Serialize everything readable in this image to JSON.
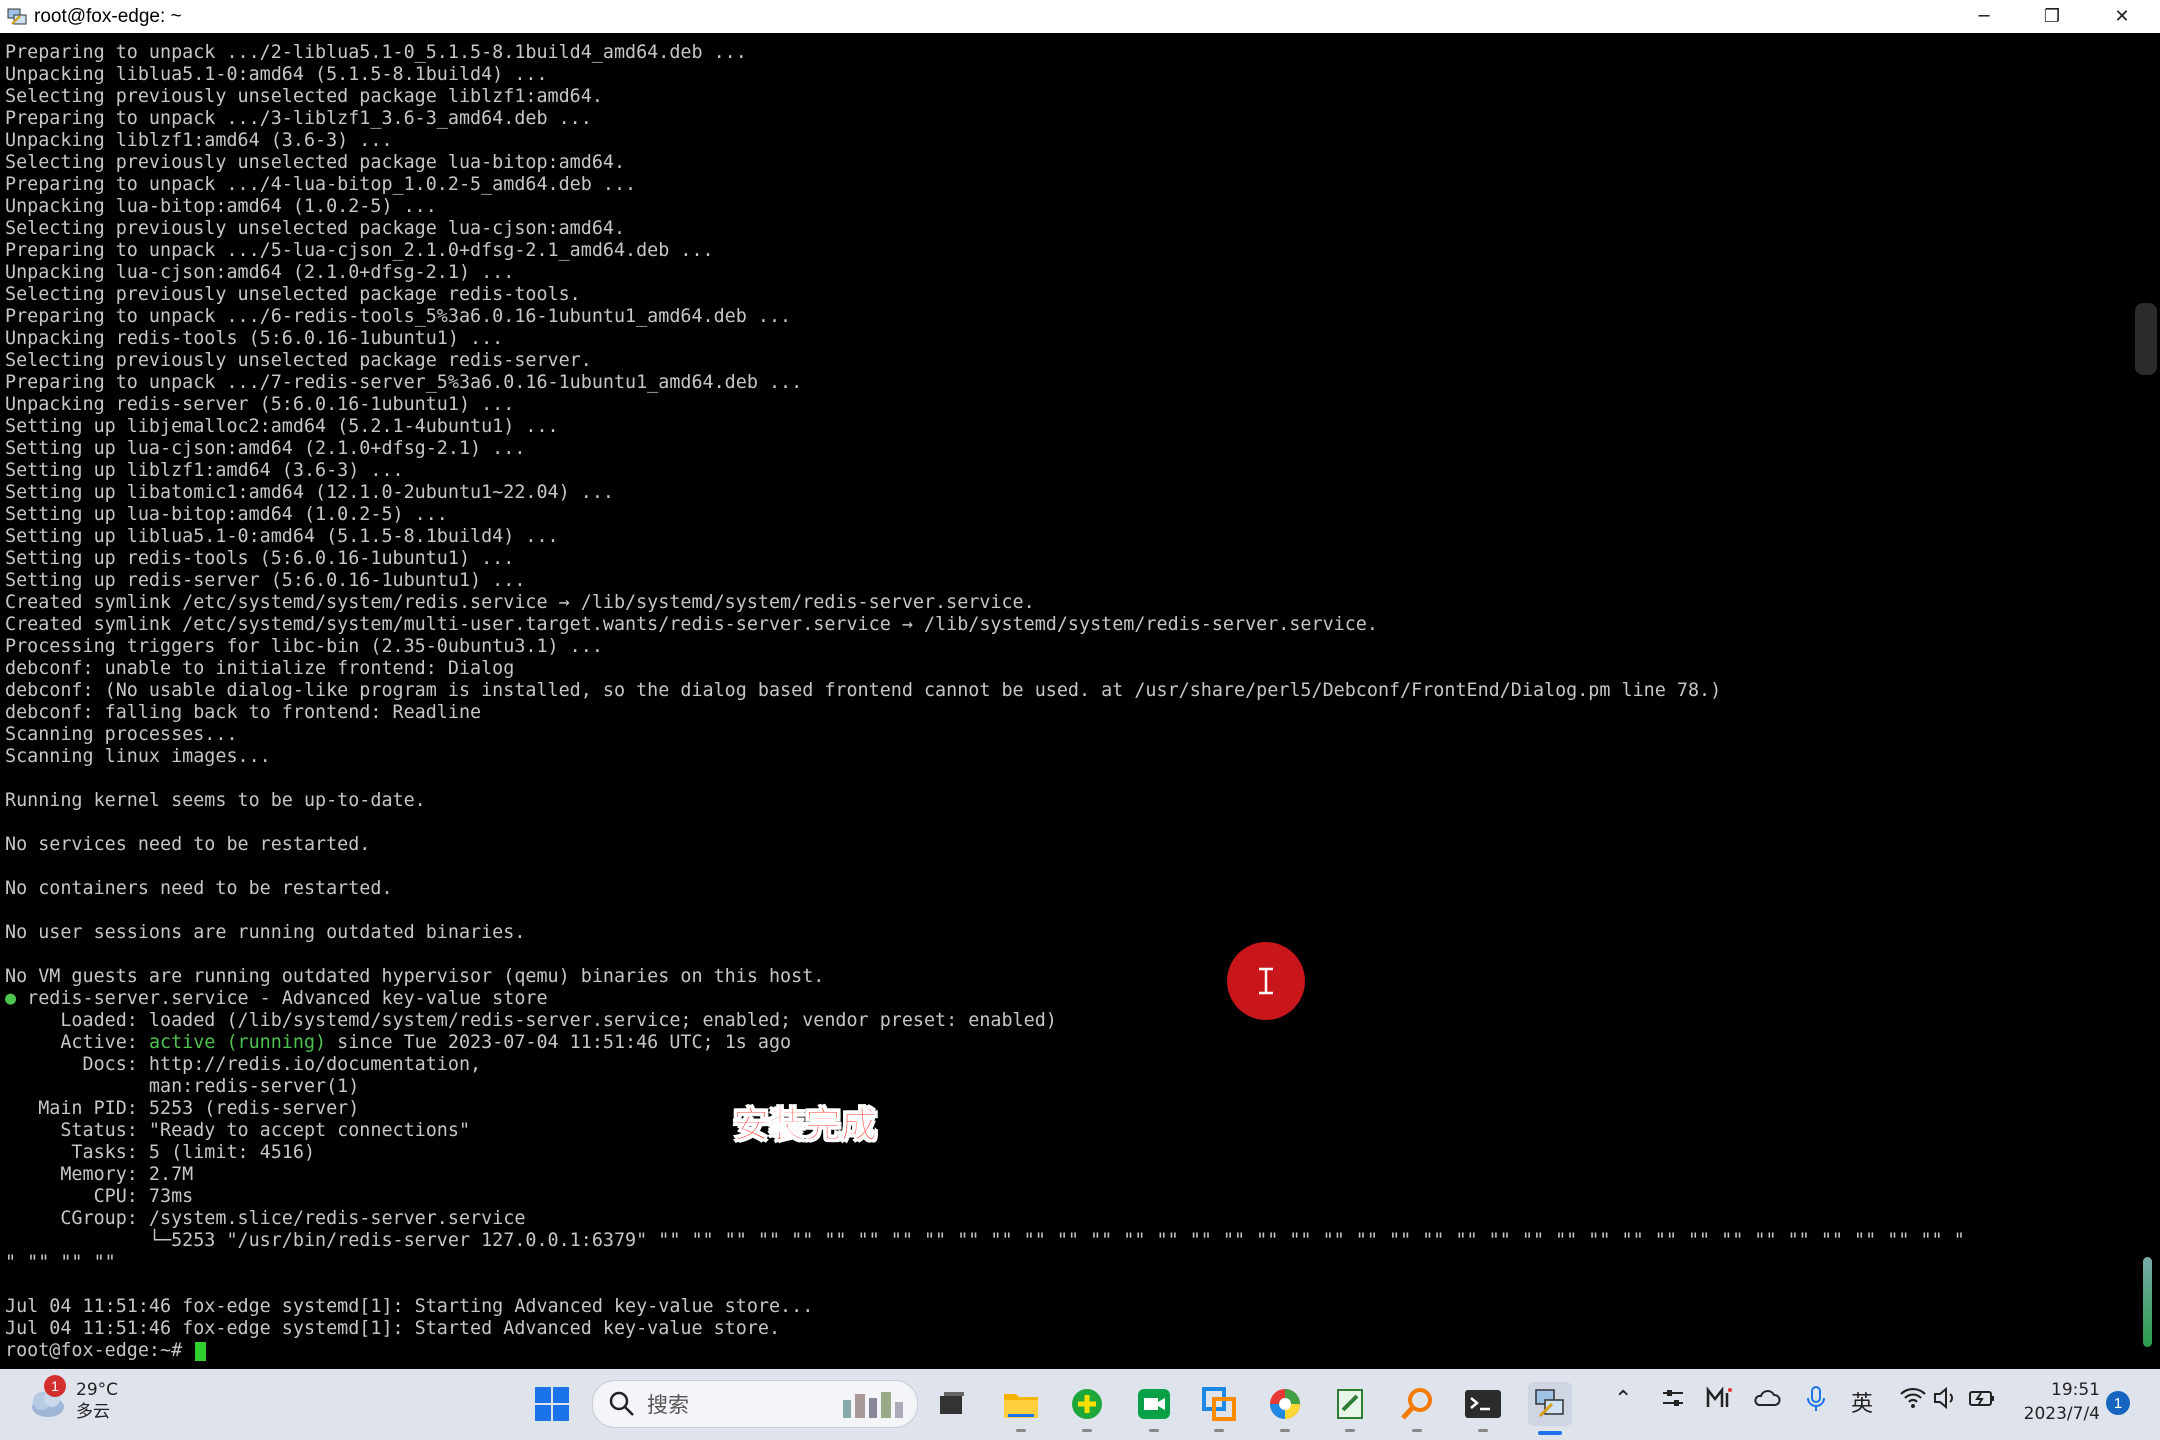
{
  "window": {
    "title": "root@fox-edge: ~",
    "minimize": "─",
    "restore": "❐",
    "close": "✕"
  },
  "terminal": {
    "lines": [
      "Preparing to unpack .../2-liblua5.1-0_5.1.5-8.1build4_amd64.deb ...",
      "Unpacking liblua5.1-0:amd64 (5.1.5-8.1build4) ...",
      "Selecting previously unselected package liblzf1:amd64.",
      "Preparing to unpack .../3-liblzf1_3.6-3_amd64.deb ...",
      "Unpacking liblzf1:amd64 (3.6-3) ...",
      "Selecting previously unselected package lua-bitop:amd64.",
      "Preparing to unpack .../4-lua-bitop_1.0.2-5_amd64.deb ...",
      "Unpacking lua-bitop:amd64 (1.0.2-5) ...",
      "Selecting previously unselected package lua-cjson:amd64.",
      "Preparing to unpack .../5-lua-cjson_2.1.0+dfsg-2.1_amd64.deb ...",
      "Unpacking lua-cjson:amd64 (2.1.0+dfsg-2.1) ...",
      "Selecting previously unselected package redis-tools.",
      "Preparing to unpack .../6-redis-tools_5%3a6.0.16-1ubuntu1_amd64.deb ...",
      "Unpacking redis-tools (5:6.0.16-1ubuntu1) ...",
      "Selecting previously unselected package redis-server.",
      "Preparing to unpack .../7-redis-server_5%3a6.0.16-1ubuntu1_amd64.deb ...",
      "Unpacking redis-server (5:6.0.16-1ubuntu1) ...",
      "Setting up libjemalloc2:amd64 (5.2.1-4ubuntu1) ...",
      "Setting up lua-cjson:amd64 (2.1.0+dfsg-2.1) ...",
      "Setting up liblzf1:amd64 (3.6-3) ...",
      "Setting up libatomic1:amd64 (12.1.0-2ubuntu1~22.04) ...",
      "Setting up lua-bitop:amd64 (1.0.2-5) ...",
      "Setting up liblua5.1-0:amd64 (5.1.5-8.1build4) ...",
      "Setting up redis-tools (5:6.0.16-1ubuntu1) ...",
      "Setting up redis-server (5:6.0.16-1ubuntu1) ...",
      "Created symlink /etc/systemd/system/redis.service → /lib/systemd/system/redis-server.service.",
      "Created symlink /etc/systemd/system/multi-user.target.wants/redis-server.service → /lib/systemd/system/redis-server.service.",
      "Processing triggers for libc-bin (2.35-0ubuntu3.1) ...",
      "debconf: unable to initialize frontend: Dialog",
      "debconf: (No usable dialog-like program is installed, so the dialog based frontend cannot be used. at /usr/share/perl5/Debconf/FrontEnd/Dialog.pm line 78.)",
      "debconf: falling back to frontend: Readline",
      "Scanning processes...",
      "Scanning linux images...",
      "",
      "Running kernel seems to be up-to-date.",
      "",
      "No services need to be restarted.",
      "",
      "No containers need to be restarted.",
      "",
      "No user sessions are running outdated binaries.",
      "",
      "No VM guests are running outdated hypervisor (qemu) binaries on this host."
    ],
    "status_dot": "●",
    "status_head": " redis-server.service - Advanced key-value store",
    "loaded": "     Loaded: loaded (/lib/systemd/system/redis-server.service; enabled; vendor preset: enabled)",
    "active_label": "     Active: ",
    "active_state": "active (running)",
    "active_rest": " since Tue 2023-07-04 11:51:46 UTC; 1s ago",
    "lines2": [
      "       Docs: http://redis.io/documentation,",
      "             man:redis-server(1)",
      "   Main PID: 5253 (redis-server)",
      "     Status: \"Ready to accept connections\"",
      "      Tasks: 5 (limit: 4516)",
      "     Memory: 2.7M",
      "        CPU: 73ms",
      "     CGroup: /system.slice/redis-server.service",
      "             └─5253 \"/usr/bin/redis-server 127.0.0.1:6379\" \"\" \"\" \"\" \"\" \"\" \"\" \"\" \"\" \"\" \"\" \"\" \"\" \"\" \"\" \"\" \"\" \"\" \"\" \"\" \"\" \"\" \"\" \"\" \"\" \"\" \"\" \"\" \"\" \"\" \"\" \"\" \"\" \"\" \"\" \"\" \"\" \"\" \"\" \"\" \"",
      "\" \"\" \"\" \"\"",
      "",
      "Jul 04 11:51:46 fox-edge systemd[1]: Starting Advanced key-value store...",
      "Jul 04 11:51:46 fox-edge systemd[1]: Started Advanced key-value store."
    ],
    "prompt": "root@fox-edge:~# "
  },
  "overlay": {
    "cursor_glyph": "I",
    "subtitle": "安装完成"
  },
  "taskbar": {
    "weather_badge": "1",
    "temperature": "29°C",
    "condition": "多云",
    "search_label": "搜索",
    "tray_ime": "英",
    "time": "19:51",
    "date": "2023/7/4",
    "notification_count": "1"
  }
}
